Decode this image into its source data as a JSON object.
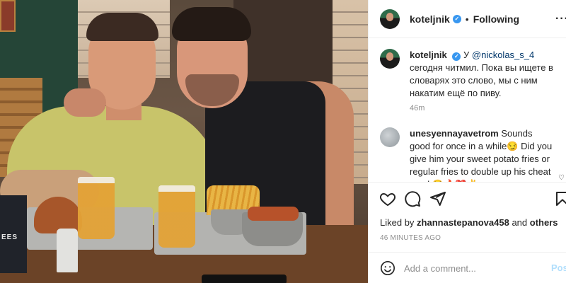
{
  "post": {
    "username": "koteljnik",
    "follow_status": "Following",
    "separator": "•",
    "more_icon": "more-horizontal-icon",
    "photo_text": "EES"
  },
  "caption": {
    "username": "koteljnik",
    "prefix": "У",
    "mention": "@nickolas_s_4",
    "text": "сегодня читмил. Пока вы ищете в словарях это слово, мы с ним накатим ещё по пиву.",
    "time": "46m"
  },
  "comment": {
    "username": "unesyennayavetrom",
    "text": "Sounds good for once in a while😏 Did you give him your sweet potato fries or regular fries to double up his cheat meal 😂🔥❤️✌️"
  },
  "actions": {
    "icons": [
      "heart-icon",
      "comment-icon",
      "share-icon",
      "bookmark-icon"
    ]
  },
  "likes": {
    "prefix": "Liked by",
    "user": "zhannastepanova458",
    "middle": "and",
    "others": "others"
  },
  "timestamp": "46 MINUTES AGO",
  "add_comment": {
    "placeholder": "Add a comment...",
    "post_label": "Post"
  },
  "colors": {
    "verified": "#3897f0",
    "mention": "#00376b",
    "post_disabled": "#b2dffc",
    "secondary_text": "#8e8e8e"
  }
}
